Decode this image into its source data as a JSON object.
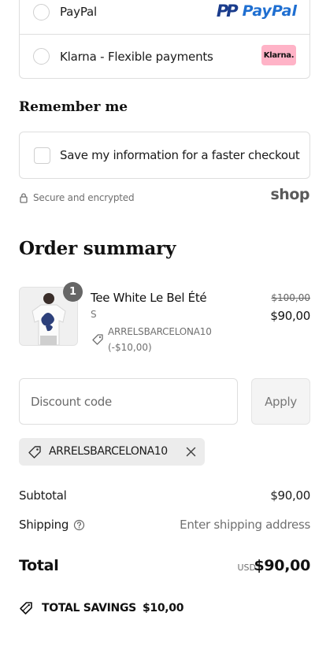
{
  "payment": {
    "options": [
      {
        "label": "PayPal",
        "logo_text": "PayPal"
      },
      {
        "label": "Klarna - Flexible payments",
        "logo_text": "Klarna."
      }
    ]
  },
  "remember": {
    "title": "Remember me",
    "checkbox_label": "Save my information for a faster checkout",
    "secure_text": "Secure and encrypted",
    "shop_logo": "shop"
  },
  "summary": {
    "title": "Order summary",
    "item": {
      "quantity": "1",
      "name": "Tee White Le Bel Été",
      "variant": "S",
      "discount_code": "ARRELSBARCELONA10",
      "discount_amount": "(-$10,00)",
      "original_price": "$100,00",
      "price": "$90,00"
    },
    "discount": {
      "placeholder": "Discount code",
      "apply_label": "Apply",
      "applied_code": "ARRELSBARCELONA10"
    },
    "subtotal_label": "Subtotal",
    "subtotal_value": "$90,00",
    "shipping_label": "Shipping",
    "shipping_value": "Enter shipping address",
    "total_label": "Total",
    "total_currency": "USD",
    "total_value": "$90,00",
    "savings_label": "TOTAL SAVINGS",
    "savings_value": "$10,00"
  },
  "colors": {
    "klarna_pink": "#ffb3c7",
    "paypal_dark": "#1a3c8c",
    "paypal_light": "#1f6fd1"
  }
}
